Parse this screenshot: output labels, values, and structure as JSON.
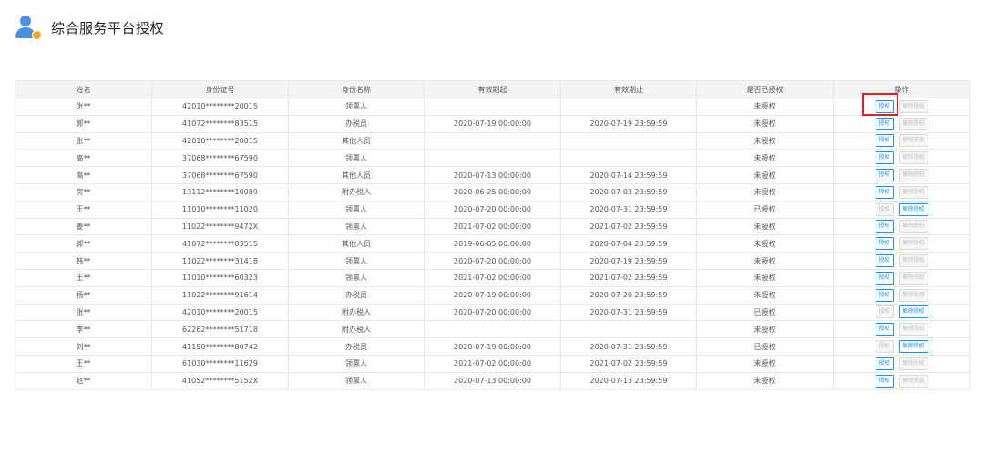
{
  "header": {
    "title": "综合服务平台授权",
    "icon": "user-gear-icon"
  },
  "table": {
    "columns": [
      "姓名",
      "身份证号",
      "身份名称",
      "有效期起",
      "有效期止",
      "是否已授权",
      "操作"
    ],
    "button_labels": {
      "authorize": "授权",
      "revoke": "解除授权"
    },
    "rows": [
      {
        "name": "张**",
        "id": "42010********20015",
        "role": "领票人",
        "start": "",
        "end": "",
        "status": "未授权",
        "authorized": false
      },
      {
        "name": "郭**",
        "id": "41072********83515",
        "role": "办税员",
        "start": "2020-07-19 00:00:00",
        "end": "2020-07-19 23:59:59",
        "status": "未授权",
        "authorized": false
      },
      {
        "name": "张**",
        "id": "42010********20015",
        "role": "其他人员",
        "start": "",
        "end": "",
        "status": "未授权",
        "authorized": false
      },
      {
        "name": "高**",
        "id": "37068********67590",
        "role": "领票人",
        "start": "",
        "end": "",
        "status": "未授权",
        "authorized": false
      },
      {
        "name": "高**",
        "id": "37068********67590",
        "role": "其他人员",
        "start": "2020-07-13 00:00:00",
        "end": "2020-07-14 23:59:59",
        "status": "未授权",
        "authorized": false
      },
      {
        "name": "房**",
        "id": "13112********10089",
        "role": "附办税人",
        "start": "2020-06-25 00:00:00",
        "end": "2020-07-03 23:59:59",
        "status": "未授权",
        "authorized": false
      },
      {
        "name": "王**",
        "id": "11010********11020",
        "role": "领票人",
        "start": "2020-07-20 00:00:00",
        "end": "2020-07-31 23:59:59",
        "status": "已授权",
        "authorized": true
      },
      {
        "name": "姜**",
        "id": "11022********9472X",
        "role": "领票人",
        "start": "2021-07-02 00:00:00",
        "end": "2021-07-02 23:59:59",
        "status": "未授权",
        "authorized": false
      },
      {
        "name": "郭**",
        "id": "41072********83515",
        "role": "其他人员",
        "start": "2019-06-05 00:00:00",
        "end": "2020-07-04 23:59:59",
        "status": "未授权",
        "authorized": false
      },
      {
        "name": "韩**",
        "id": "11022********31418",
        "role": "领票人",
        "start": "2020-07-20 00:00:00",
        "end": "2020-07-19 23:59:59",
        "status": "未授权",
        "authorized": false
      },
      {
        "name": "王**",
        "id": "11010********60323",
        "role": "领票人",
        "start": "2021-07-02 00:00:00",
        "end": "2021-07-02 23:59:59",
        "status": "未授权",
        "authorized": false
      },
      {
        "name": "杨**",
        "id": "11022********91614",
        "role": "办税员",
        "start": "2020-07-19 00:00:00",
        "end": "2020-07-20 23:59:59",
        "status": "未授权",
        "authorized": false
      },
      {
        "name": "张**",
        "id": "42010********20015",
        "role": "附办税人",
        "start": "2020-07-20 00:00:00",
        "end": "2020-07-31 23:59:59",
        "status": "已授权",
        "authorized": true
      },
      {
        "name": "李**",
        "id": "62262********51718",
        "role": "附办税人",
        "start": "",
        "end": "",
        "status": "未授权",
        "authorized": false
      },
      {
        "name": "刘**",
        "id": "41150********80742",
        "role": "办税员",
        "start": "2020-07-19 00:00:00",
        "end": "2020-07-31 23:59:59",
        "status": "已授权",
        "authorized": true
      },
      {
        "name": "王**",
        "id": "61030********11629",
        "role": "领票人",
        "start": "2021-07-02 00:00:00",
        "end": "2021-07-02 23:59:59",
        "status": "未授权",
        "authorized": false
      },
      {
        "name": "赵**",
        "id": "41052********5152X",
        "role": "领票人",
        "start": "2020-07-13 00:00:00",
        "end": "2020-07-13 23:59:59",
        "status": "未授权",
        "authorized": false
      }
    ]
  },
  "colors": {
    "accent": "#1890ff",
    "highlight": "#e02020",
    "header_bg": "#f4f4f4",
    "border": "#e8e8e8"
  }
}
